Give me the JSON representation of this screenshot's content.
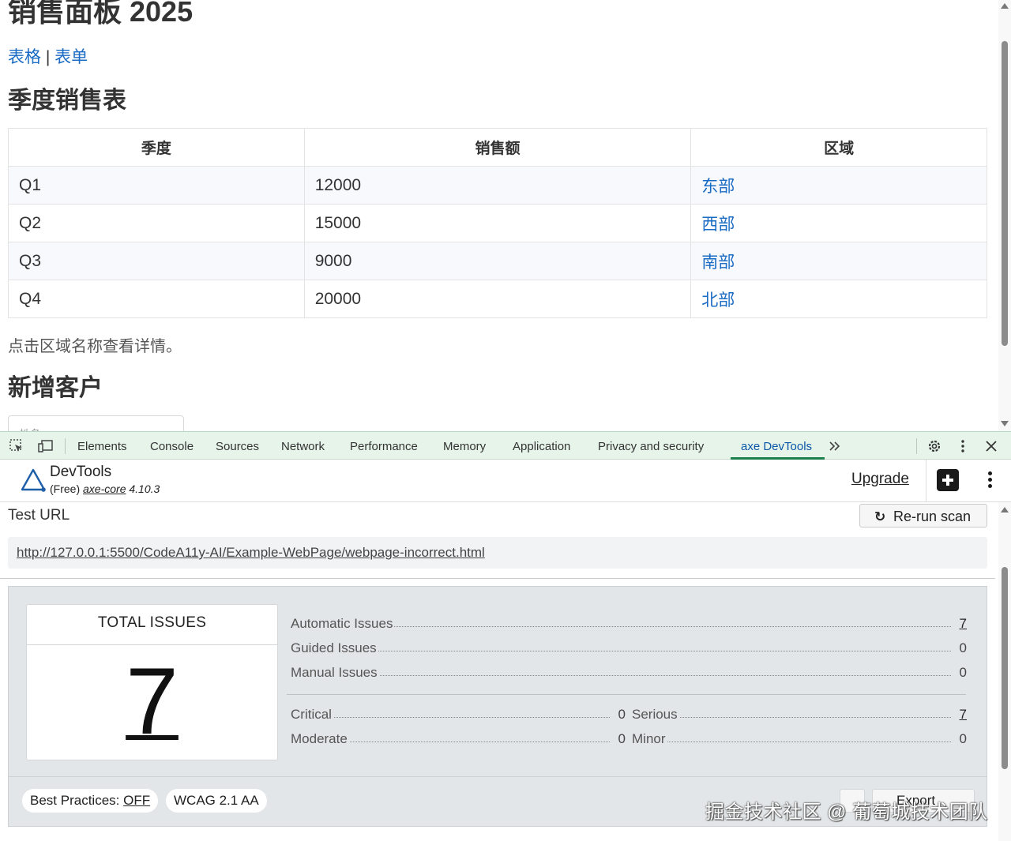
{
  "page": {
    "title": "销售面板 2025",
    "nav": {
      "link1": "表格",
      "divider": "|",
      "link2": "表单"
    },
    "table_heading": "季度销售表",
    "table": {
      "headers": [
        "季度",
        "销售额",
        "区域"
      ],
      "rows": [
        {
          "quarter": "Q1",
          "sales": "12000",
          "region": "东部"
        },
        {
          "quarter": "Q2",
          "sales": "15000",
          "region": "西部"
        },
        {
          "quarter": "Q3",
          "sales": "9000",
          "region": "南部"
        },
        {
          "quarter": "Q4",
          "sales": "20000",
          "region": "北部"
        }
      ]
    },
    "note": "点击区域名称查看详情。",
    "form_heading": "新增客户",
    "form_placeholder_partial": "姓名"
  },
  "devtools": {
    "tabs": [
      "Elements",
      "Console",
      "Sources",
      "Network",
      "Performance",
      "Memory",
      "Application",
      "Privacy and security",
      "axe DevTools"
    ],
    "active_tab": "axe DevTools",
    "accent_color": "#1a7f4b"
  },
  "axe": {
    "name": "DevTools",
    "plan": "(Free)",
    "core_label": "axe-core",
    "core_version": "4.10.3",
    "upgrade": "Upgrade",
    "test_url_label": "Test URL",
    "rerun": "Re-run scan",
    "url": "http://127.0.0.1:5500/CodeA11y-AI/Example-WebPage/webpage-incorrect.html",
    "total_label": "TOTAL ISSUES",
    "total": "7",
    "automatic_label": "Automatic Issues",
    "automatic": "7",
    "guided_label": "Guided Issues",
    "guided": "0",
    "manual_label": "Manual Issues",
    "manual": "0",
    "critical_label": "Critical",
    "critical": "0",
    "serious_label": "Serious",
    "serious": "7",
    "moderate_label": "Moderate",
    "moderate": "0",
    "minor_label": "Minor",
    "minor": "0",
    "best_practices_label": "Best Practices:",
    "best_practices_value": "OFF",
    "standard": "WCAG 2.1 AA",
    "export": "Export"
  },
  "watermark": "掘金技术社区 @ 葡萄城技术团队"
}
